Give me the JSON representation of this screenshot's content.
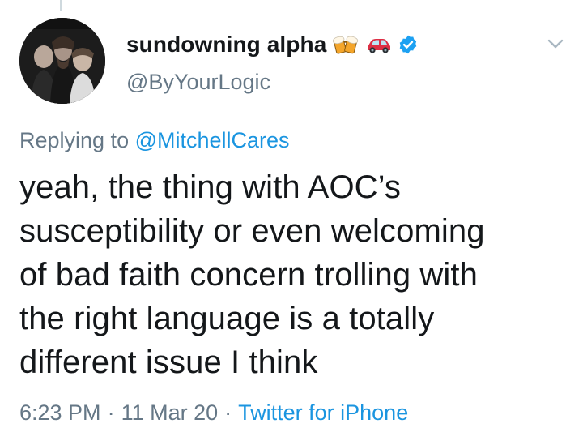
{
  "tweet": {
    "author": {
      "display_name": "sundowning alpha",
      "handle": "@ByYourLogic",
      "verified": true,
      "name_emojis": [
        "beer-mugs-icon",
        "car-icon"
      ]
    },
    "replying_to": {
      "prefix": "Replying to",
      "handle": "@MitchellCares"
    },
    "text_lines": [
      "yeah, the thing with AOC’s",
      "susceptibility or even welcoming",
      "of bad faith concern trolling with",
      "the right language is a totally",
      "different issue I think"
    ],
    "meta": {
      "time": "6:23 PM",
      "date": "11 Mar 20",
      "separator": "·",
      "source": "Twitter for iPhone"
    }
  },
  "colors": {
    "link": "#1b95e0",
    "secondary_text": "#657786",
    "primary_text": "#14171a",
    "verified_badge": "#1da1f2"
  }
}
